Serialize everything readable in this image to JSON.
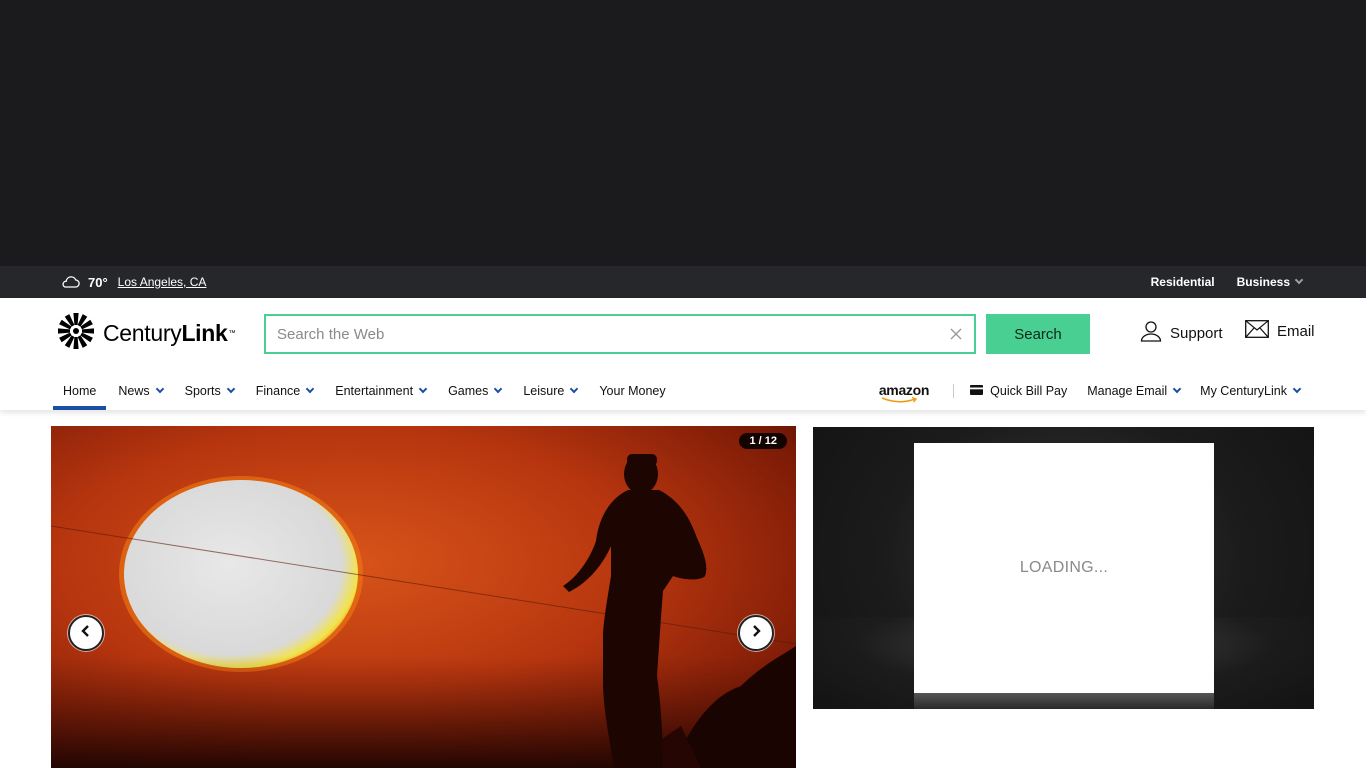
{
  "topbar": {
    "weather": {
      "icon": "cloud-icon",
      "temp": "70°",
      "location": "Los Angeles, CA"
    },
    "links": [
      {
        "label": "Residential"
      },
      {
        "label": "Business",
        "has_dropdown": true
      }
    ]
  },
  "header": {
    "logo": {
      "text_regular": "Century",
      "text_bold": "Link",
      "tm": "™"
    },
    "search": {
      "placeholder": "Search the Web",
      "value": "",
      "button_label": "Search"
    },
    "utility": {
      "support_label": "Support",
      "email_label": "Email"
    }
  },
  "nav": {
    "items": [
      {
        "label": "Home",
        "active": true,
        "dropdown": false
      },
      {
        "label": "News",
        "dropdown": true
      },
      {
        "label": "Sports",
        "dropdown": true
      },
      {
        "label": "Finance",
        "dropdown": true
      },
      {
        "label": "Entertainment",
        "dropdown": true
      },
      {
        "label": "Games",
        "dropdown": true
      },
      {
        "label": "Leisure",
        "dropdown": true
      },
      {
        "label": "Your Money",
        "dropdown": false
      }
    ],
    "right": {
      "amazon": "amazon",
      "quick_bill_pay": "Quick Bill Pay",
      "manage_email": "Manage Email",
      "my_centurylink": "My CenturyLink"
    }
  },
  "slideshow": {
    "counter": "1 / 12",
    "current": 1,
    "total": 12
  },
  "ad": {
    "loading_text": "LOADING..."
  },
  "colors": {
    "accent_green": "#49cf92",
    "nav_blue": "#1a4fa5",
    "topbar_bg": "#26272a",
    "banner_bg": "#1b1b1d"
  }
}
